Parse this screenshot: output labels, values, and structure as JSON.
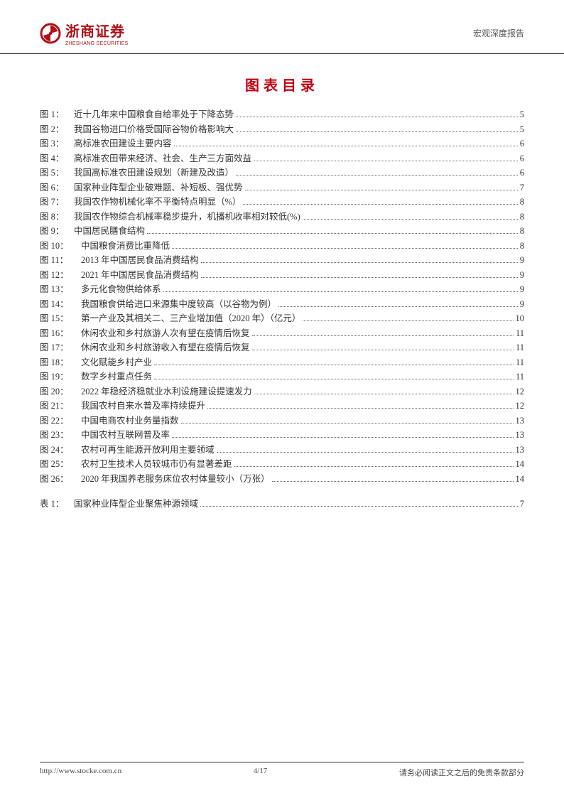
{
  "header": {
    "brand_cn": "浙商证券",
    "brand_en": "ZHESHANG SECURITIES",
    "right": "宏观深度报告"
  },
  "title": "图表目录",
  "figures": [
    {
      "label": "图 1：",
      "text": "近十几年来中国粮食自给率处于下降态势",
      "page": "5"
    },
    {
      "label": "图 2：",
      "text": "我国谷物进口价格受国际谷物价格影响大",
      "page": "5"
    },
    {
      "label": "图 3：",
      "text": "高标准农田建设主要内容",
      "page": "6"
    },
    {
      "label": "图 4：",
      "text": "高标准农田带来经济、社会、生产三方面效益",
      "page": "6"
    },
    {
      "label": "图 5：",
      "text": "我国高标准农田建设规划（新建及改造）",
      "page": "6"
    },
    {
      "label": "图 6：",
      "text": "国家种业阵型企业破难题、补短板、强优势",
      "page": "7"
    },
    {
      "label": "图 7：",
      "text": "我国农作物机械化率不平衡特点明显（%）",
      "page": "8"
    },
    {
      "label": "图 8：",
      "text": "我国农作物综合机械率稳步提升，机播机收率相对较低(%)",
      "page": "8"
    },
    {
      "label": "图 9：",
      "text": "中国居民膳食结构",
      "page": "8"
    },
    {
      "label": "图 10：",
      "text": "中国粮食消费比重降低",
      "page": "8"
    },
    {
      "label": "图 11：",
      "text": "2013 年中国居民食品消费结构",
      "page": "9"
    },
    {
      "label": "图 12：",
      "text": "2021 年中国居民食品消费结构",
      "page": "9"
    },
    {
      "label": "图 13：",
      "text": "多元化食物供给体系",
      "page": "9"
    },
    {
      "label": "图 14：",
      "text": "我国粮食供给进口来源集中度较高（以谷物为例）",
      "page": "9"
    },
    {
      "label": "图 15：",
      "text": "第一产业及其相关二、三产业增加值（2020 年）（亿元）",
      "page": "10"
    },
    {
      "label": "图 16：",
      "text": "休闲农业和乡村旅游人次有望在疫情后恢复",
      "page": "11"
    },
    {
      "label": "图 17：",
      "text": "休闲农业和乡村旅游收入有望在疫情后恢复",
      "page": "11"
    },
    {
      "label": "图 18：",
      "text": "文化赋能乡村产业",
      "page": "11"
    },
    {
      "label": "图 19：",
      "text": "数字乡村重点任务",
      "page": "11"
    },
    {
      "label": "图 20：",
      "text": "2022 年稳经济稳就业水利设施建设提速发力",
      "page": "12"
    },
    {
      "label": "图 21：",
      "text": "我国农村自来水普及率持续提升",
      "page": "12"
    },
    {
      "label": "图 22：",
      "text": "中国电商农村业务量指数",
      "page": "13"
    },
    {
      "label": "图 23：",
      "text": "中国农村互联网普及率",
      "page": "13"
    },
    {
      "label": "图 24：",
      "text": "农村可再生能源开放利用主要领域",
      "page": "13"
    },
    {
      "label": "图 25：",
      "text": "农村卫生技术人员较城市仍有显著差距",
      "page": "14"
    },
    {
      "label": "图 26：",
      "text": "2020 年我国养老服务床位农村体量较小（万张）",
      "page": "14"
    }
  ],
  "tables": [
    {
      "label": "表 1：",
      "text": "国家种业阵型企业聚焦种源领域",
      "page": "7"
    }
  ],
  "footer": {
    "url": "http://www.stocke.com.cn",
    "page": "4/17",
    "disclaimer": "请务必阅读正文之后的免责条款部分"
  }
}
